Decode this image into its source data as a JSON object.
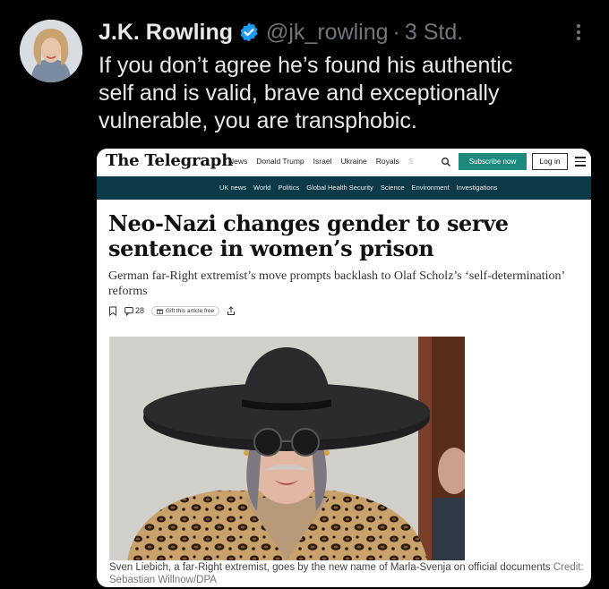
{
  "tweet": {
    "display_name": "J.K. Rowling",
    "handle": "@jk_rowling",
    "separator": "·",
    "time": "3 Std.",
    "text": "If you don’t agree he’s found his authentic\nself and is valid, brave and exceptionally\nvulnerable, you are transphobic.",
    "icons": {
      "verified": "verified-badge-icon",
      "more": "more-options-icon",
      "avatar": "avatar"
    },
    "accent_color": "#1d9bf0"
  },
  "article": {
    "site": {
      "logo": "The Telegraph",
      "nav": [
        "News",
        "Donald Trump",
        "Israel",
        "Ukraine",
        "Royals",
        "S"
      ],
      "subscribe_label": "Subscribe now",
      "login_label": "Log in",
      "subnav": [
        "UK news",
        "World",
        "Politics",
        "Global Health Security",
        "Science",
        "Environment",
        "Investigations"
      ],
      "subscribe_color": "#1d8a7d",
      "subnav_color": "#0d3a48"
    },
    "headline": "Neo-Nazi changes gender to serve sentence in women’s prison",
    "standfirst": "German far-Right extremist’s move prompts backlash to Olaf Scholz’s ‘self-determination’ reforms",
    "actions": {
      "comment_count": "28",
      "gift_label": "Gift this article free"
    },
    "caption": "Sven Liebich, a far-Right extremist, goes by the new name of Marla-Svenja on official documents",
    "credit": "Credit: Sebastian Willnow/DPA"
  }
}
